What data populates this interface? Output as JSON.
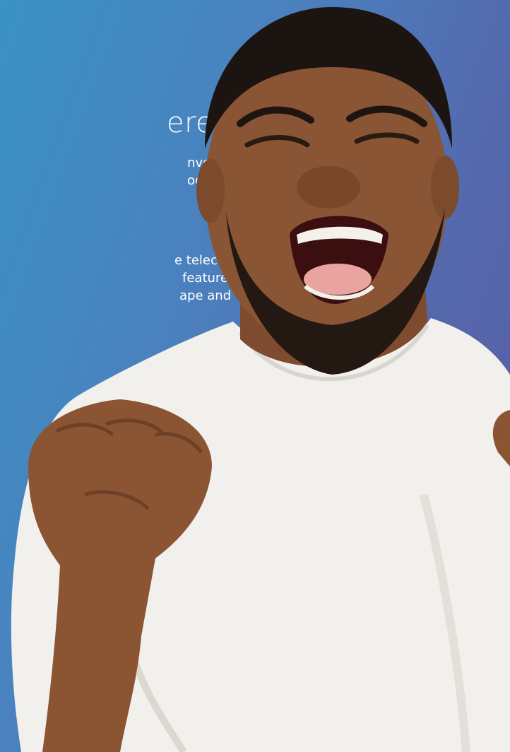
{
  "headline": "ere!",
  "paragraph1": {
    "line1": "nvolve a",
    "line2": "ocess for"
  },
  "paragraph2": {
    "line1": "e telecoms",
    "line2": "features.",
    "line3": "ape and"
  },
  "colors": {
    "gradient_start": "#3a93c2",
    "gradient_end": "#5c5aa4",
    "text": "#ffffff",
    "shirt": "#f2f0ec",
    "skin": "#8a5535"
  }
}
